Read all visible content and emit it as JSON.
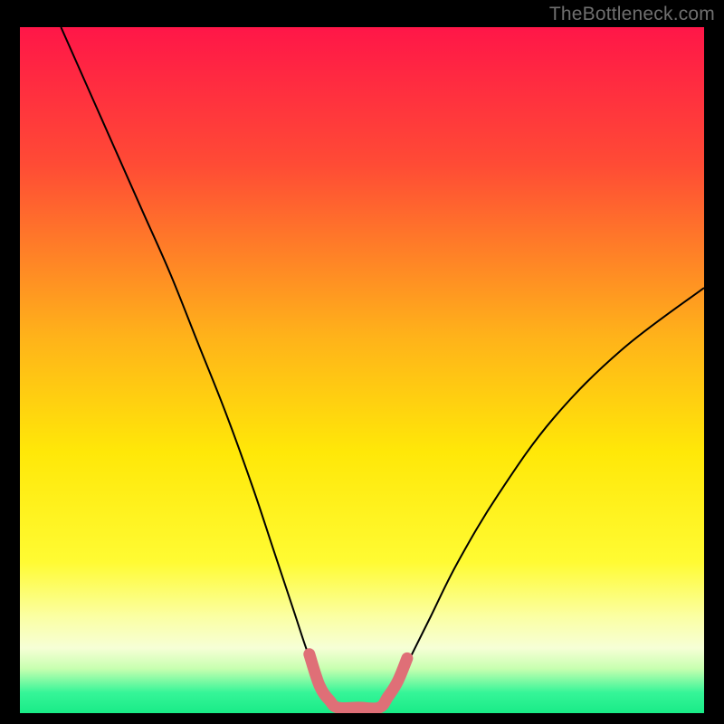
{
  "watermark": "TheBottleneck.com",
  "chart_data": {
    "type": "line",
    "title": "",
    "xlabel": "",
    "ylabel": "",
    "xlim": [
      0,
      100
    ],
    "ylim": [
      0,
      100
    ],
    "grid": false,
    "legend": false,
    "background_gradient": {
      "stops": [
        {
          "offset": 0.0,
          "color": "#ff1648"
        },
        {
          "offset": 0.2,
          "color": "#ff4b35"
        },
        {
          "offset": 0.45,
          "color": "#ffb21a"
        },
        {
          "offset": 0.62,
          "color": "#ffe808"
        },
        {
          "offset": 0.78,
          "color": "#fffb33"
        },
        {
          "offset": 0.86,
          "color": "#fbffa4"
        },
        {
          "offset": 0.905,
          "color": "#f6ffd6"
        },
        {
          "offset": 0.935,
          "color": "#c8ffb0"
        },
        {
          "offset": 0.97,
          "color": "#36f598"
        },
        {
          "offset": 1.0,
          "color": "#19eb87"
        }
      ]
    },
    "series": [
      {
        "name": "bottleneck-curve",
        "stroke": "#000000",
        "stroke_width": 2,
        "x": [
          6,
          10,
          14,
          18,
          22,
          26,
          30,
          34,
          37,
          40,
          42,
          44,
          46.5,
          52.5,
          55,
          57,
          60,
          64,
          70,
          78,
          88,
          100
        ],
        "y": [
          100,
          91,
          82,
          73,
          64,
          54,
          44,
          33,
          24,
          15,
          9,
          4,
          0.8,
          0.8,
          4,
          8,
          14,
          22,
          32,
          43,
          53,
          62
        ]
      },
      {
        "name": "flat-zone-highlight",
        "stroke": "#df6f77",
        "stroke_width": 13,
        "linecap": "round",
        "x": [
          42.3,
          43.8,
          45.3,
          46.5,
          49.5,
          52.5,
          53.8,
          55.2,
          56.6
        ],
        "y": [
          8.6,
          4.0,
          1.8,
          0.8,
          0.8,
          0.8,
          2.4,
          4.6,
          8.0
        ]
      }
    ]
  }
}
